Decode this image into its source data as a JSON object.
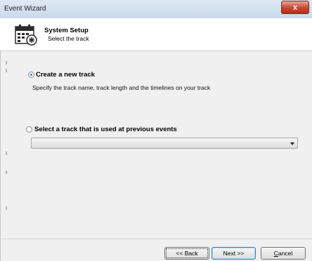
{
  "window": {
    "title": "Event Wizard",
    "close_label": "x"
  },
  "header": {
    "title": "System Setup",
    "subtitle": "Select the track",
    "icon": "calendar-settings-icon"
  },
  "options": {
    "create_new": {
      "label": "Create a new track",
      "description": "Specify the track name, track length and the timelines on your track",
      "checked": true
    },
    "select_previous": {
      "label": "Select a track that is used at previous events",
      "checked": false
    }
  },
  "track_select": {
    "value": ""
  },
  "buttons": {
    "back": "<< Back",
    "next": "Next >>",
    "cancel_first": "C",
    "cancel_rest": "ancel"
  },
  "colors": {
    "accent": "#2a77c9",
    "close": "#c9452f"
  }
}
